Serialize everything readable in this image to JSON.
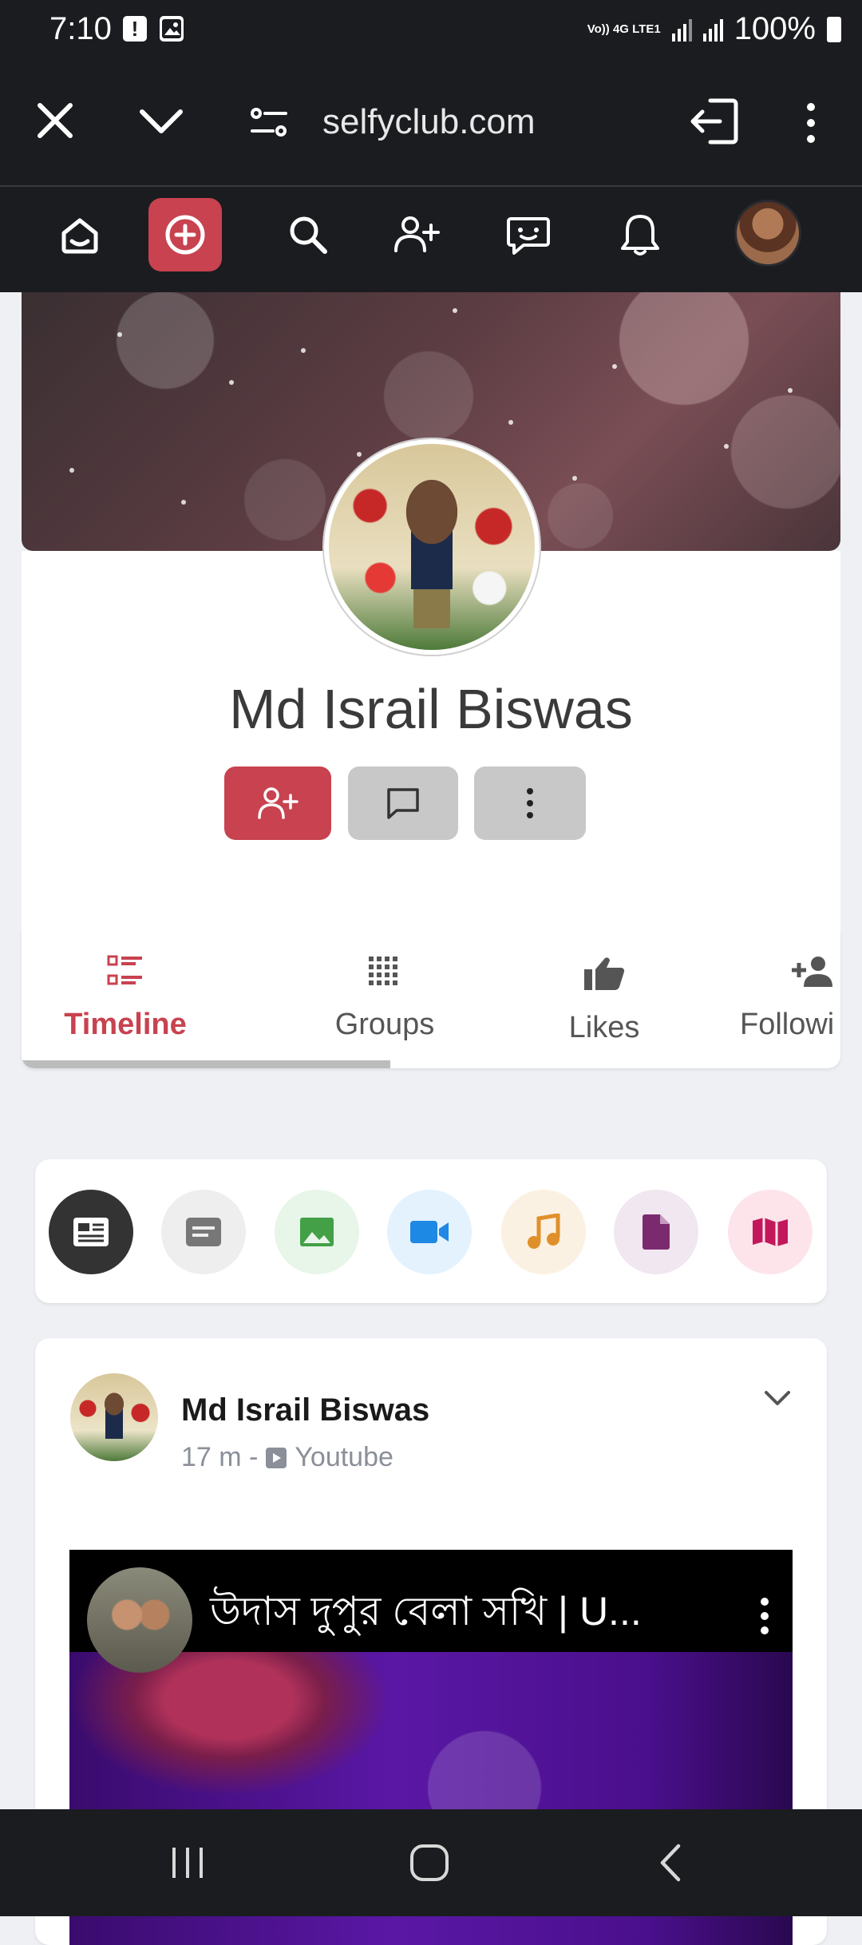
{
  "status_bar": {
    "time": "7:10",
    "notification_icons": [
      "!",
      "image-icon"
    ],
    "network": "Vo)) 4G LTE1",
    "battery": "100%"
  },
  "browser": {
    "url": "selfyclub.com",
    "icons": [
      "close-icon",
      "chevron-down-icon",
      "site-settings-icon",
      "sign-in-icon",
      "more-vert-icon"
    ]
  },
  "site_nav": {
    "items": [
      "home-icon",
      "create-post-icon",
      "search-icon",
      "add-friend-icon",
      "messages-icon",
      "notifications-icon",
      "avatar"
    ],
    "accent": "#c8424f"
  },
  "profile": {
    "name": "Md Israil Biswas",
    "buttons": [
      "add-friend-button",
      "message-button",
      "more-button"
    ]
  },
  "tabs": [
    {
      "label": "Timeline",
      "icon": "timeline-icon",
      "active": true
    },
    {
      "label": "Groups",
      "icon": "groups-icon",
      "active": false
    },
    {
      "label": "Likes",
      "icon": "thumbs-up-icon",
      "active": false
    },
    {
      "label": "Followi",
      "icon": "person-add-icon",
      "active": false
    }
  ],
  "post_types": [
    {
      "icon": "article-icon",
      "bg": "#333333",
      "fg": "#ffffff"
    },
    {
      "icon": "text-icon",
      "bg": "#eeeeee",
      "fg": "#777777"
    },
    {
      "icon": "image-icon",
      "bg": "#e8f5e9",
      "fg": "#43a047"
    },
    {
      "icon": "video-icon",
      "bg": "#e3f2fd",
      "fg": "#1e88e5"
    },
    {
      "icon": "music-icon",
      "bg": "#fbf1e2",
      "fg": "#e0902a"
    },
    {
      "icon": "file-icon",
      "bg": "#f1e7f0",
      "fg": "#7b2a6e"
    },
    {
      "icon": "map-icon",
      "bg": "#fce4ea",
      "fg": "#c2185b"
    }
  ],
  "post": {
    "author": "Md Israil Biswas",
    "time": "17 m -",
    "source": "Youtube",
    "video_title": "উদাস দুপুর বেলা সখি | U..."
  }
}
